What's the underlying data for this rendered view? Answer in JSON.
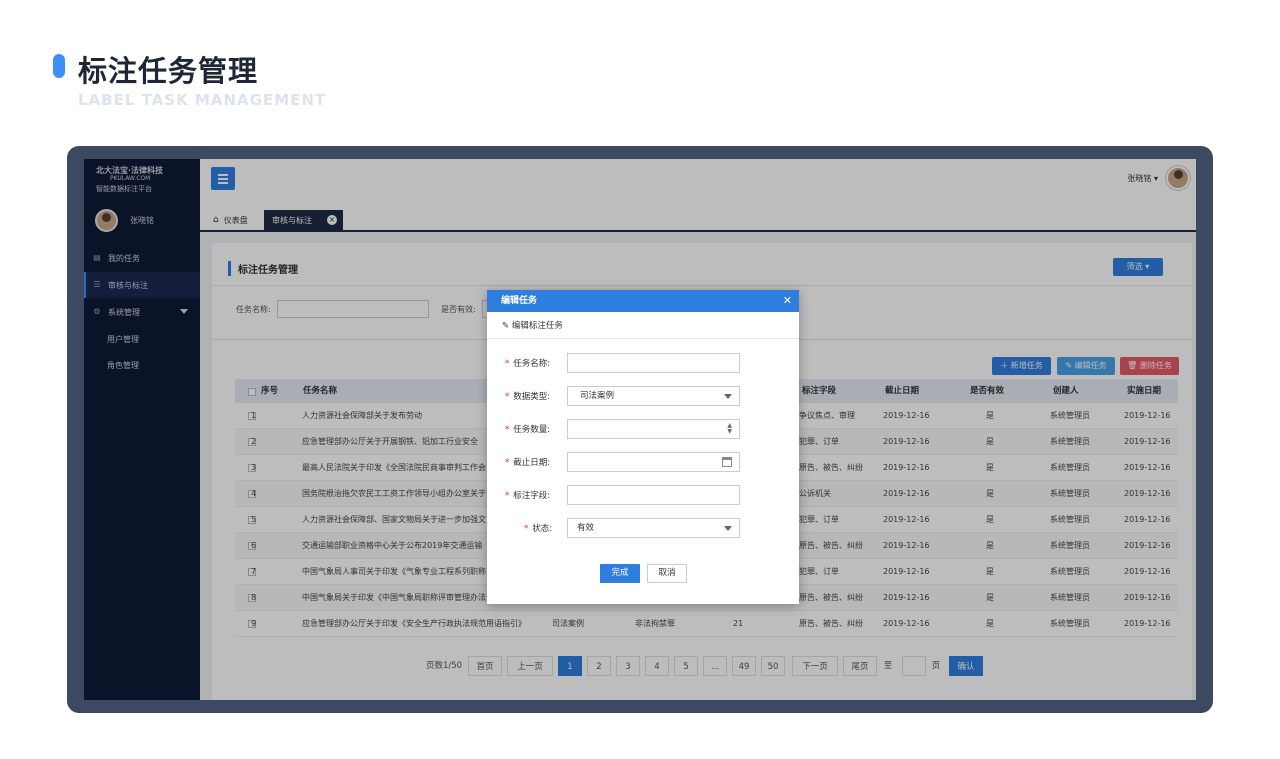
{
  "header": {
    "title": "标注任务管理",
    "subtitle": "LABEL TASK MANAGEMENT"
  },
  "sidebar": {
    "logo": {
      "line1": "北大法宝·法律科技",
      "line2": "PKULAW.COM",
      "line3": "智能数据标注平台"
    },
    "user_name": "张晓铭",
    "items": [
      {
        "label": "我的任务",
        "icon": "document-icon"
      },
      {
        "label": "审核与标注",
        "icon": "checklist-icon"
      },
      {
        "label": "系统管理",
        "icon": "gear-icon"
      },
      {
        "label": "用户管理"
      },
      {
        "label": "角色管理"
      }
    ]
  },
  "topbar": {
    "user_name": "张晓铭 ▾"
  },
  "tabs": [
    {
      "label": "仪表盘"
    },
    {
      "label": "审核与标注"
    }
  ],
  "page": {
    "title": "标注任务管理",
    "filter_button": "筛选",
    "search": {
      "name_label": "任务名称:",
      "valid_label": "是否有效:"
    },
    "actions": {
      "add": "新增任务",
      "edit": "编辑任务",
      "delete": "删除任务"
    },
    "columns": [
      "序号",
      "任务名称",
      "标注字段",
      "截止日期",
      "是否有效",
      "创建人",
      "实施日期"
    ],
    "rows": [
      {
        "no": "1",
        "name": "人力资源社会保障部关于发布劳动",
        "type": "",
        "sub": "",
        "count": "",
        "field": "争议焦点、审理",
        "deadline": "2019-12-16",
        "valid": "是",
        "creator": "系统管理员",
        "date": "2019-12-16"
      },
      {
        "no": "2",
        "name": "应急管理部办公厅关于开展钢铁、铝加工行业安全",
        "type": "",
        "sub": "",
        "count": "",
        "field": "犯罪、订单",
        "deadline": "2019-12-16",
        "valid": "是",
        "creator": "系统管理员",
        "date": "2019-12-16"
      },
      {
        "no": "3",
        "name": "最高人民法院关于印发《全国法院民商事审判工作会",
        "type": "",
        "sub": "",
        "count": "",
        "field": "原告、被告、纠纷",
        "deadline": "2019-12-16",
        "valid": "是",
        "creator": "系统管理员",
        "date": "2019-12-16"
      },
      {
        "no": "4",
        "name": "国务院根治拖欠农民工工资工作领导小组办公室关于",
        "type": "",
        "sub": "",
        "count": "",
        "field": "公诉机关",
        "deadline": "2019-12-16",
        "valid": "是",
        "creator": "系统管理员",
        "date": "2019-12-16"
      },
      {
        "no": "5",
        "name": "人力资源社会保障部、国家文物局关于进一步加强文",
        "type": "",
        "sub": "",
        "count": "",
        "field": "犯罪、订单",
        "deadline": "2019-12-16",
        "valid": "是",
        "creator": "系统管理员",
        "date": "2019-12-16"
      },
      {
        "no": "6",
        "name": "交通运输部职业资格中心关于公布2019年交通运输",
        "type": "",
        "sub": "",
        "count": "",
        "field": "原告、被告、纠纷",
        "deadline": "2019-12-16",
        "valid": "是",
        "creator": "系统管理员",
        "date": "2019-12-16"
      },
      {
        "no": "7",
        "name": "中国气象局人事司关于印发《气象专业工程系列职称",
        "type": "",
        "sub": "",
        "count": "",
        "field": "犯罪、订单",
        "deadline": "2019-12-16",
        "valid": "是",
        "creator": "系统管理员",
        "date": "2019-12-16"
      },
      {
        "no": "8",
        "name": "中国气象局关于印发《中国气象局职称评审管理办法",
        "type": "",
        "sub": "",
        "count": "",
        "field": "原告、被告、纠纷",
        "deadline": "2019-12-16",
        "valid": "是",
        "creator": "系统管理员",
        "date": "2019-12-16"
      },
      {
        "no": "9",
        "name": "应急管理部办公厅关于印发《安全生产行政执法规范用语指引》",
        "type": "司法案例",
        "sub": "非法拘禁罪",
        "count": "21",
        "field": "原告、被告、纠纷",
        "deadline": "2019-12-16",
        "valid": "是",
        "creator": "系统管理员",
        "date": "2019-12-16"
      }
    ],
    "pager": {
      "total": "页数1/50",
      "first": "首页",
      "prev": "上一页",
      "pages": [
        "1",
        "2",
        "3",
        "4",
        "5",
        "...",
        "49",
        "50"
      ],
      "next": "下一页",
      "last": "尾页",
      "goto": "至",
      "page_unit": "页",
      "confirm": "确认"
    }
  },
  "modal": {
    "title": "编辑任务",
    "subtitle": "编辑标注任务",
    "fields": {
      "name_label": "任务名称:",
      "type_label": "数据类型:",
      "type_value": "司法案例",
      "count_label": "任务数量:",
      "deadline_label": "截止日期:",
      "field_label": "标注字段:",
      "status_label": "状态:",
      "status_value": "有效"
    },
    "ok": "完成",
    "cancel": "取消"
  }
}
